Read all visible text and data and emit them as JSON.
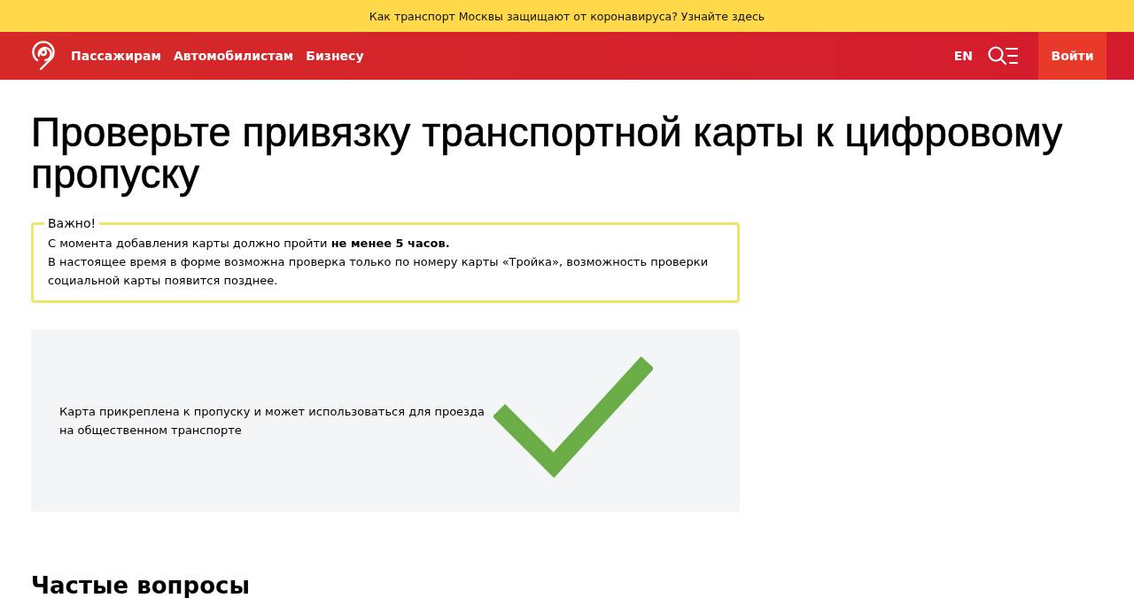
{
  "banner": {
    "text": "Как транспорт Москвы защищают от коронавируса? Узнайте здесь"
  },
  "header": {
    "nav": [
      "Пассажирам",
      "Автомобилистам",
      "Бизнесу"
    ],
    "language": "EN",
    "login": "Войти"
  },
  "title": "Проверьте привязку транспортной карты к цифровому пропуску",
  "notice": {
    "legend": "Важно!",
    "lines": [
      "С момента добавления карты должно пройти **не менее 5 часов.**",
      "В настоящее время в форме возможна проверка только по номеру карты «Тройка», возможность проверки социальной карты появится позднее."
    ]
  },
  "result": {
    "attached": true,
    "message": "Карта прикреплена к пропуску и может использоваться для проезда на общественном транспорте"
  },
  "faq_heading": "Частые вопросы"
}
